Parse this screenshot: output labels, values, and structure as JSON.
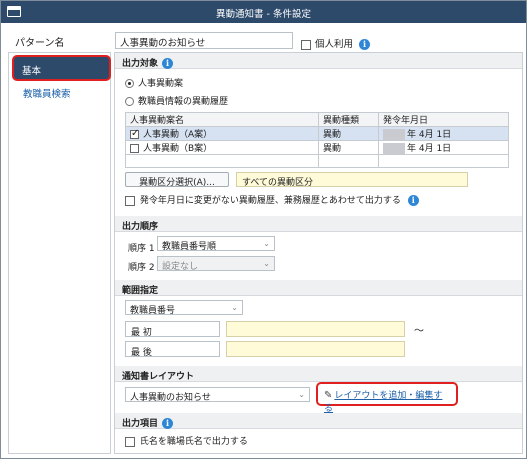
{
  "window": {
    "title": "異動通知書 - 条件設定"
  },
  "pattern": {
    "label": "パターン名",
    "value": "人事異動のお知らせ",
    "personal_use_label": "個人利用",
    "personal_use_checked": false
  },
  "sidebar": {
    "items": [
      {
        "label": "基本",
        "active": true
      },
      {
        "label": "教職員検索",
        "active": false
      }
    ]
  },
  "output_target": {
    "header": "出力対象",
    "radio_personnel": "人事異動案",
    "radio_history": "教職員情報の異動履歴",
    "selected": "人事異動案",
    "columns": [
      "人事異動案名",
      "異動種類",
      "発令年月日"
    ],
    "rows": [
      {
        "checked": true,
        "name": "人事異動（A案）",
        "type": "異動",
        "date": "年 4月 1日"
      },
      {
        "checked": false,
        "name": "人事異動（B案）",
        "type": "異動",
        "date": "年 4月 1日"
      }
    ],
    "select_button": "異動区分選択(A)...",
    "all_categories": "すべての異動区分",
    "also_output_label": "発令年月日に変更がない異動履歴、兼務履歴とあわせて出力する",
    "also_output_checked": false
  },
  "output_order": {
    "header": "出力順序",
    "order1_label": "順序 1",
    "order1_value": "教職員番号順",
    "order2_label": "順序 2",
    "order2_value": "設定なし"
  },
  "range": {
    "header": "範囲指定",
    "field_value": "教職員番号",
    "first_label": "最 初",
    "last_label": "最 後",
    "tilde": "～"
  },
  "layout": {
    "header": "通知書レイアウト",
    "value": "人事異動のお知らせ",
    "edit_link": "レイアウトを追加・編集する"
  },
  "output_items": {
    "header": "出力項目",
    "name_label": "氏名を職場氏名で出力する",
    "name_checked": false
  }
}
